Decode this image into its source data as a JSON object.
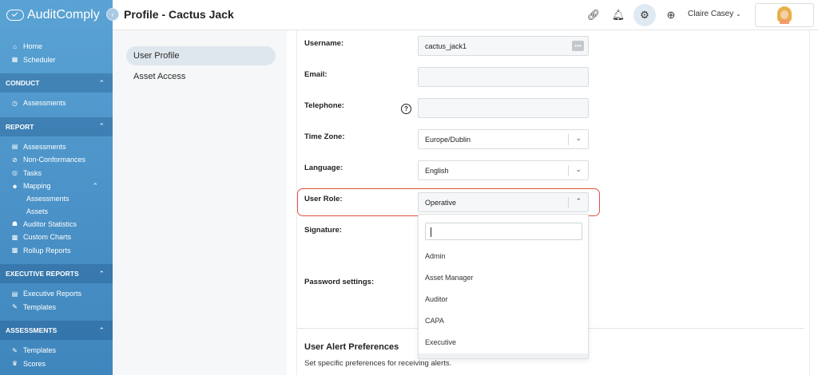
{
  "app": {
    "name": "AuditComply"
  },
  "sidebar": {
    "top_items": [
      {
        "label": "Home",
        "icon": "home-icon"
      },
      {
        "label": "Scheduler",
        "icon": "calendar-icon"
      }
    ],
    "sections": {
      "conduct": {
        "title": "CONDUCT",
        "items": [
          "Assessments"
        ]
      },
      "report": {
        "title": "REPORT",
        "items": [
          "Assessments",
          "Non-Conformances",
          "Tasks",
          "Mapping"
        ],
        "mapping_sub": [
          "Assessments",
          "Assets"
        ],
        "items_after": [
          "Auditor Statistics",
          "Custom Charts",
          "Rollup Reports"
        ]
      },
      "executive": {
        "title": "EXECUTIVE REPORTS",
        "items": [
          "Executive Reports",
          "Templates"
        ]
      },
      "assessments": {
        "title": "ASSESSMENTS",
        "items": [
          "Templates",
          "Scores"
        ]
      }
    }
  },
  "header": {
    "title": "Profile - Cactus Jack",
    "user_name": "Claire Casey"
  },
  "subnav": {
    "items": [
      "User Profile",
      "Asset Access"
    ],
    "active": "User Profile"
  },
  "form": {
    "username_label": "Username:",
    "username_value": "cactus_jack1",
    "email_label": "Email:",
    "email_value": "",
    "telephone_label": "Telephone:",
    "telephone_value": "",
    "timezone_label": "Time Zone:",
    "timezone_value": "Europe/Dublin",
    "language_label": "Language:",
    "language_value": "English",
    "role_label": "User Role:",
    "role_value": "Operative",
    "signature_label": "Signature:",
    "password_label": "Password settings:"
  },
  "dropdown": {
    "search_value": "",
    "options": [
      "Admin",
      "Asset Manager",
      "Auditor",
      "CAPA",
      "Executive"
    ]
  },
  "alerts": {
    "title": "User Alert Preferences",
    "description": "Set specific preferences for receiving alerts."
  },
  "colors": {
    "sidebar_top": "#5aa3d4",
    "sidebar_bottom": "#3f86bd",
    "highlight": "#e0543f",
    "field_bg": "#f5f7f8"
  }
}
